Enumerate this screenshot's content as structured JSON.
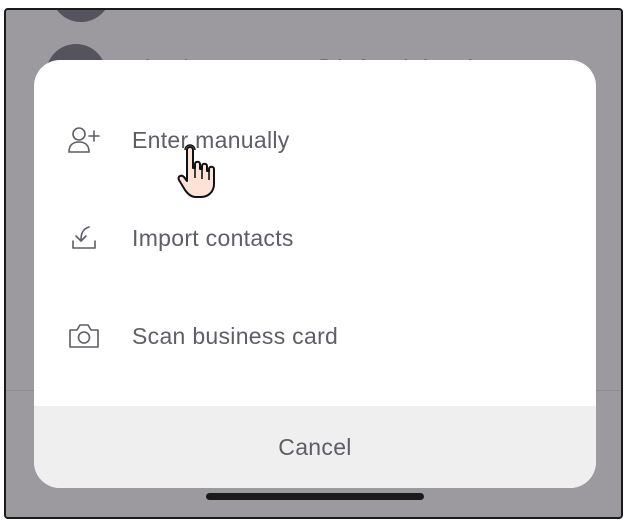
{
  "background": {
    "email_partial": "chad_NoName@infomichaels.com"
  },
  "sheet": {
    "options": [
      {
        "label": "Enter manually",
        "icon": "add-person-icon"
      },
      {
        "label": "Import contacts",
        "icon": "import-download-icon"
      },
      {
        "label": "Scan business card",
        "icon": "camera-icon"
      }
    ],
    "cancel_label": "Cancel"
  },
  "colors": {
    "overlay": "#9c9a9f",
    "sheet_bg": "#ffffff",
    "cancel_bg": "#efefef",
    "text": "#5f5d66"
  }
}
